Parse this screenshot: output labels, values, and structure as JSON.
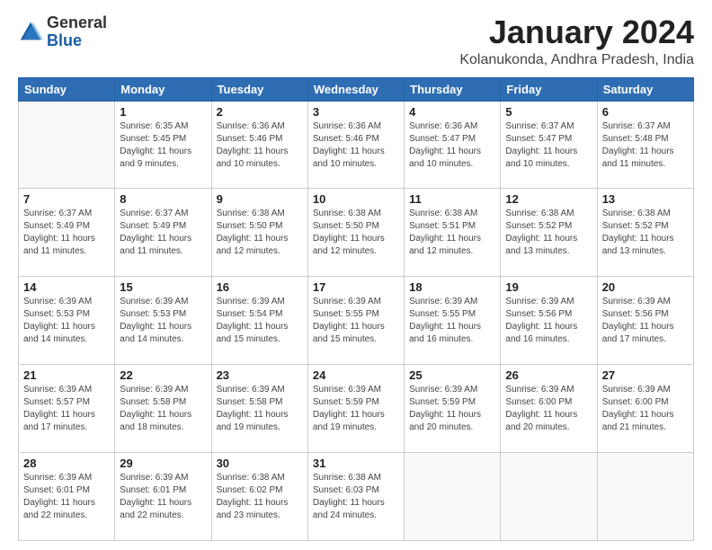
{
  "logo": {
    "general": "General",
    "blue": "Blue"
  },
  "title": "January 2024",
  "location": "Kolanukonda, Andhra Pradesh, India",
  "days_of_week": [
    "Sunday",
    "Monday",
    "Tuesday",
    "Wednesday",
    "Thursday",
    "Friday",
    "Saturday"
  ],
  "weeks": [
    [
      {
        "day": "",
        "sunrise": "",
        "sunset": "",
        "daylight": ""
      },
      {
        "day": "1",
        "sunrise": "Sunrise: 6:35 AM",
        "sunset": "Sunset: 5:45 PM",
        "daylight": "Daylight: 11 hours and 9 minutes."
      },
      {
        "day": "2",
        "sunrise": "Sunrise: 6:36 AM",
        "sunset": "Sunset: 5:46 PM",
        "daylight": "Daylight: 11 hours and 10 minutes."
      },
      {
        "day": "3",
        "sunrise": "Sunrise: 6:36 AM",
        "sunset": "Sunset: 5:46 PM",
        "daylight": "Daylight: 11 hours and 10 minutes."
      },
      {
        "day": "4",
        "sunrise": "Sunrise: 6:36 AM",
        "sunset": "Sunset: 5:47 PM",
        "daylight": "Daylight: 11 hours and 10 minutes."
      },
      {
        "day": "5",
        "sunrise": "Sunrise: 6:37 AM",
        "sunset": "Sunset: 5:47 PM",
        "daylight": "Daylight: 11 hours and 10 minutes."
      },
      {
        "day": "6",
        "sunrise": "Sunrise: 6:37 AM",
        "sunset": "Sunset: 5:48 PM",
        "daylight": "Daylight: 11 hours and 11 minutes."
      }
    ],
    [
      {
        "day": "7",
        "sunrise": "Sunrise: 6:37 AM",
        "sunset": "Sunset: 5:49 PM",
        "daylight": "Daylight: 11 hours and 11 minutes."
      },
      {
        "day": "8",
        "sunrise": "Sunrise: 6:37 AM",
        "sunset": "Sunset: 5:49 PM",
        "daylight": "Daylight: 11 hours and 11 minutes."
      },
      {
        "day": "9",
        "sunrise": "Sunrise: 6:38 AM",
        "sunset": "Sunset: 5:50 PM",
        "daylight": "Daylight: 11 hours and 12 minutes."
      },
      {
        "day": "10",
        "sunrise": "Sunrise: 6:38 AM",
        "sunset": "Sunset: 5:50 PM",
        "daylight": "Daylight: 11 hours and 12 minutes."
      },
      {
        "day": "11",
        "sunrise": "Sunrise: 6:38 AM",
        "sunset": "Sunset: 5:51 PM",
        "daylight": "Daylight: 11 hours and 12 minutes."
      },
      {
        "day": "12",
        "sunrise": "Sunrise: 6:38 AM",
        "sunset": "Sunset: 5:52 PM",
        "daylight": "Daylight: 11 hours and 13 minutes."
      },
      {
        "day": "13",
        "sunrise": "Sunrise: 6:38 AM",
        "sunset": "Sunset: 5:52 PM",
        "daylight": "Daylight: 11 hours and 13 minutes."
      }
    ],
    [
      {
        "day": "14",
        "sunrise": "Sunrise: 6:39 AM",
        "sunset": "Sunset: 5:53 PM",
        "daylight": "Daylight: 11 hours and 14 minutes."
      },
      {
        "day": "15",
        "sunrise": "Sunrise: 6:39 AM",
        "sunset": "Sunset: 5:53 PM",
        "daylight": "Daylight: 11 hours and 14 minutes."
      },
      {
        "day": "16",
        "sunrise": "Sunrise: 6:39 AM",
        "sunset": "Sunset: 5:54 PM",
        "daylight": "Daylight: 11 hours and 15 minutes."
      },
      {
        "day": "17",
        "sunrise": "Sunrise: 6:39 AM",
        "sunset": "Sunset: 5:55 PM",
        "daylight": "Daylight: 11 hours and 15 minutes."
      },
      {
        "day": "18",
        "sunrise": "Sunrise: 6:39 AM",
        "sunset": "Sunset: 5:55 PM",
        "daylight": "Daylight: 11 hours and 16 minutes."
      },
      {
        "day": "19",
        "sunrise": "Sunrise: 6:39 AM",
        "sunset": "Sunset: 5:56 PM",
        "daylight": "Daylight: 11 hours and 16 minutes."
      },
      {
        "day": "20",
        "sunrise": "Sunrise: 6:39 AM",
        "sunset": "Sunset: 5:56 PM",
        "daylight": "Daylight: 11 hours and 17 minutes."
      }
    ],
    [
      {
        "day": "21",
        "sunrise": "Sunrise: 6:39 AM",
        "sunset": "Sunset: 5:57 PM",
        "daylight": "Daylight: 11 hours and 17 minutes."
      },
      {
        "day": "22",
        "sunrise": "Sunrise: 6:39 AM",
        "sunset": "Sunset: 5:58 PM",
        "daylight": "Daylight: 11 hours and 18 minutes."
      },
      {
        "day": "23",
        "sunrise": "Sunrise: 6:39 AM",
        "sunset": "Sunset: 5:58 PM",
        "daylight": "Daylight: 11 hours and 19 minutes."
      },
      {
        "day": "24",
        "sunrise": "Sunrise: 6:39 AM",
        "sunset": "Sunset: 5:59 PM",
        "daylight": "Daylight: 11 hours and 19 minutes."
      },
      {
        "day": "25",
        "sunrise": "Sunrise: 6:39 AM",
        "sunset": "Sunset: 5:59 PM",
        "daylight": "Daylight: 11 hours and 20 minutes."
      },
      {
        "day": "26",
        "sunrise": "Sunrise: 6:39 AM",
        "sunset": "Sunset: 6:00 PM",
        "daylight": "Daylight: 11 hours and 20 minutes."
      },
      {
        "day": "27",
        "sunrise": "Sunrise: 6:39 AM",
        "sunset": "Sunset: 6:00 PM",
        "daylight": "Daylight: 11 hours and 21 minutes."
      }
    ],
    [
      {
        "day": "28",
        "sunrise": "Sunrise: 6:39 AM",
        "sunset": "Sunset: 6:01 PM",
        "daylight": "Daylight: 11 hours and 22 minutes."
      },
      {
        "day": "29",
        "sunrise": "Sunrise: 6:39 AM",
        "sunset": "Sunset: 6:01 PM",
        "daylight": "Daylight: 11 hours and 22 minutes."
      },
      {
        "day": "30",
        "sunrise": "Sunrise: 6:38 AM",
        "sunset": "Sunset: 6:02 PM",
        "daylight": "Daylight: 11 hours and 23 minutes."
      },
      {
        "day": "31",
        "sunrise": "Sunrise: 6:38 AM",
        "sunset": "Sunset: 6:03 PM",
        "daylight": "Daylight: 11 hours and 24 minutes."
      },
      {
        "day": "",
        "sunrise": "",
        "sunset": "",
        "daylight": ""
      },
      {
        "day": "",
        "sunrise": "",
        "sunset": "",
        "daylight": ""
      },
      {
        "day": "",
        "sunrise": "",
        "sunset": "",
        "daylight": ""
      }
    ]
  ]
}
